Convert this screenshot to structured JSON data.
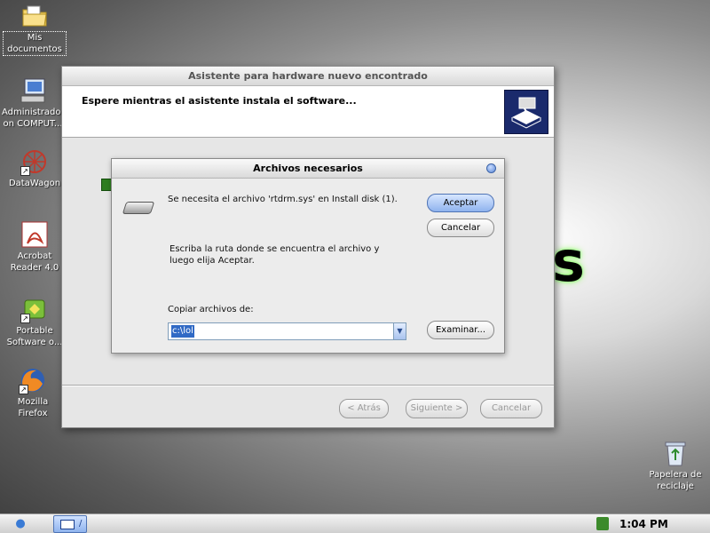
{
  "desktop": {
    "icons": [
      {
        "label": "Mis documentos",
        "icon": "my-documents-folder-icon"
      },
      {
        "label": "Administrador on COMPUT...",
        "icon": "computer-icon"
      },
      {
        "label": "DataWagon",
        "icon": "datawagon-icon"
      },
      {
        "label": "Acrobat Reader 4.0",
        "icon": "acrobat-icon"
      },
      {
        "label": "Portable Software o...",
        "icon": "portable-software-icon"
      },
      {
        "label": "Mozilla Firefox",
        "icon": "firefox-icon"
      }
    ],
    "recycle_bin": {
      "label": "Papelera de reciclaje",
      "icon": "recycle-bin-icon"
    },
    "background_logo": "s"
  },
  "wizard": {
    "title": "Asistente para hardware nuevo encontrado",
    "header_text": "Espere mientras el asistente instala el software...",
    "back_label": "< Atrás",
    "next_label": "Siguiente >",
    "cancel_label": "Cancelar"
  },
  "dialog": {
    "title": "Archivos necesarios",
    "message": "Se necesita el archivo 'rtdrm.sys' en Install disk (1).",
    "instruction": "Escriba la ruta donde se encuentra el archivo y luego elija Aceptar.",
    "copy_from_label": "Copiar archivos de:",
    "copy_from_value": "c:\\lol",
    "ok_label": "Aceptar",
    "cancel_label": "Cancelar",
    "browse_label": "Examinar..."
  },
  "taskbar": {
    "clock": "1:04 PM",
    "task_separator": "/"
  },
  "colors": {
    "selection": "#316ac5",
    "primary_button": "#8fb3ee",
    "header_image": "#1a2a6c"
  }
}
